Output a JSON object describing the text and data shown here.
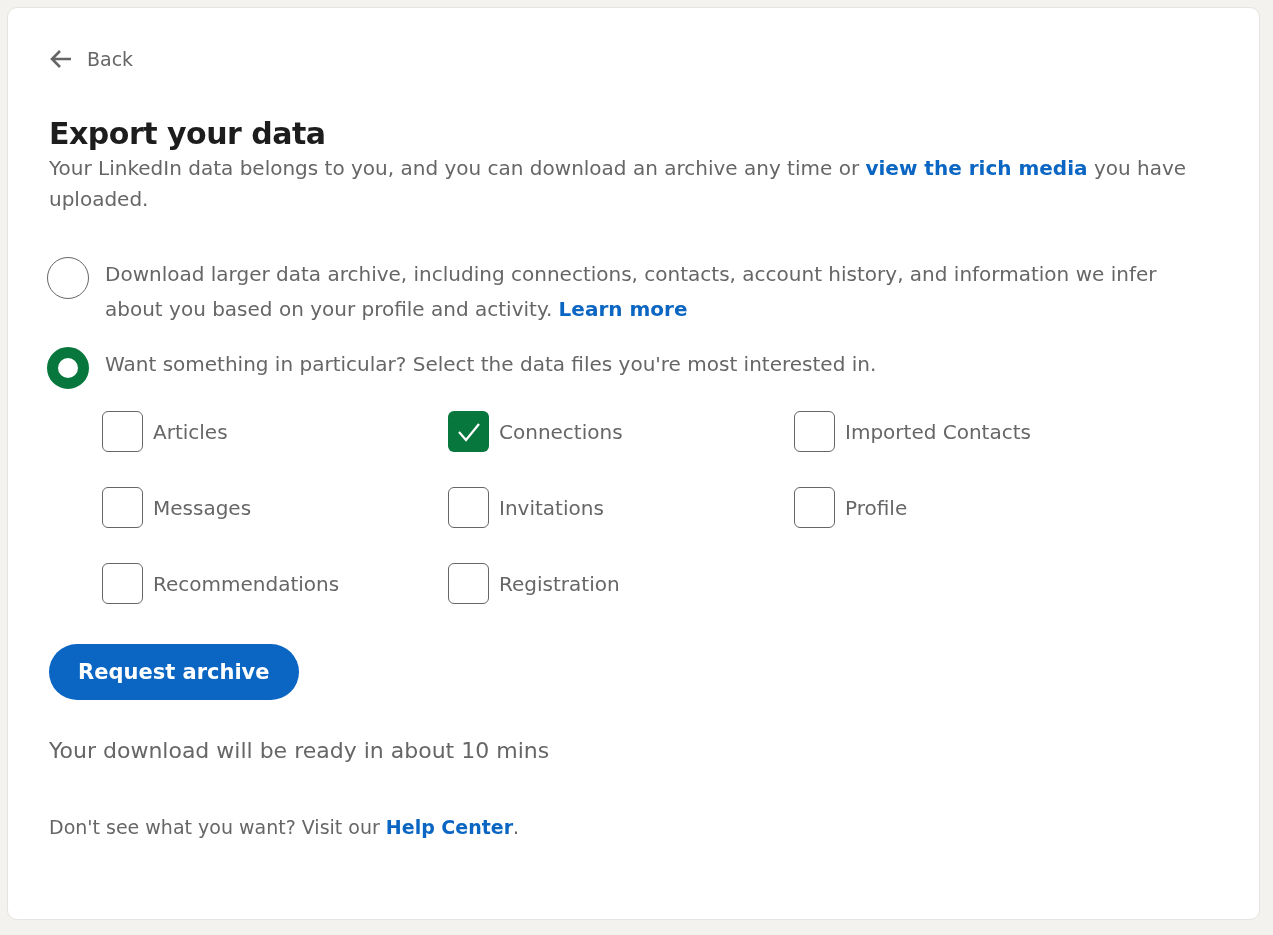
{
  "back": {
    "label": "Back"
  },
  "title": "Export your data",
  "description": {
    "before": "Your LinkedIn data belongs to you, and you can download an archive any time or",
    "link": "view the rich media",
    "after": "you have uploaded."
  },
  "options": [
    {
      "text": "Download larger data archive, including connections, contacts, account history, and information we infer about you based on your profile and activity.",
      "link": "Learn more",
      "selected": false
    },
    {
      "text": "Want something in particular? Select the data files you're most interested in.",
      "selected": true
    }
  ],
  "files": [
    {
      "label": "Articles",
      "checked": false
    },
    {
      "label": "Connections",
      "checked": true
    },
    {
      "label": "Imported Contacts",
      "checked": false
    },
    {
      "label": "Messages",
      "checked": false
    },
    {
      "label": "Invitations",
      "checked": false
    },
    {
      "label": "Profile",
      "checked": false
    },
    {
      "label": "Recommendations",
      "checked": false
    },
    {
      "label": "Registration",
      "checked": false
    }
  ],
  "button": "Request archive",
  "status": "Your download will be ready in about 10 mins",
  "help": {
    "before": "Don't see what you want? Visit our",
    "link": "Help Center",
    "after": "."
  }
}
